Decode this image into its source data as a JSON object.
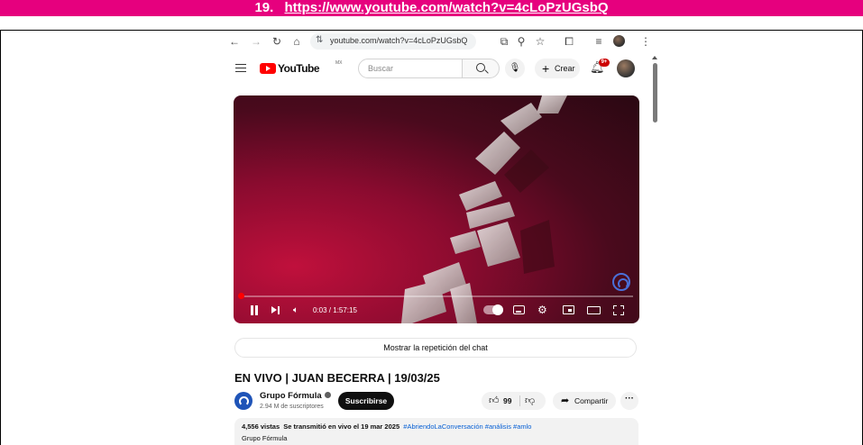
{
  "banner": {
    "number": "19.",
    "url": "https://www.youtube.com/watch?v=4cLoPzUGsbQ",
    "background": "#e6007e"
  },
  "browser": {
    "address": "youtube.com/watch?v=4cLoPzUGsbQ",
    "icons": [
      "back-icon",
      "forward-icon",
      "reload-icon",
      "home-icon",
      "site-settings-icon",
      "cast-icon",
      "zoom-icon",
      "bookmark-star-icon",
      "extensions-icon",
      "media-icon",
      "profile-avatar",
      "menu-kebab-icon"
    ]
  },
  "youtube": {
    "logo_text": "YouTube",
    "region": "MX",
    "search_placeholder": "Buscar",
    "create_label": "Crear",
    "notification_badge": "9+",
    "accent": "#ff0000"
  },
  "player": {
    "current_time": "0:03",
    "duration": "1:57:15",
    "timecode": "0:03 / 1:57:15",
    "progress_fraction": 0.0004
  },
  "chat_replay_label": "Mostrar la repetición del chat",
  "video": {
    "title": "EN VIVO | JUAN BECERRA | 19/03/25"
  },
  "channel": {
    "name": "Grupo Fórmula",
    "subscribers": "2.94 M de suscriptores",
    "subscribe_label": "Suscribirse"
  },
  "actions": {
    "likes": "99",
    "share_label": "Compartir",
    "more_label": "···"
  },
  "description": {
    "views": "4,556 vistas",
    "streamed": "Se transmitió en vivo el 19 mar 2025",
    "hashtags": "#AbriendoLaConversación #análisis #amlo",
    "org": "Grupo Fórmula"
  }
}
